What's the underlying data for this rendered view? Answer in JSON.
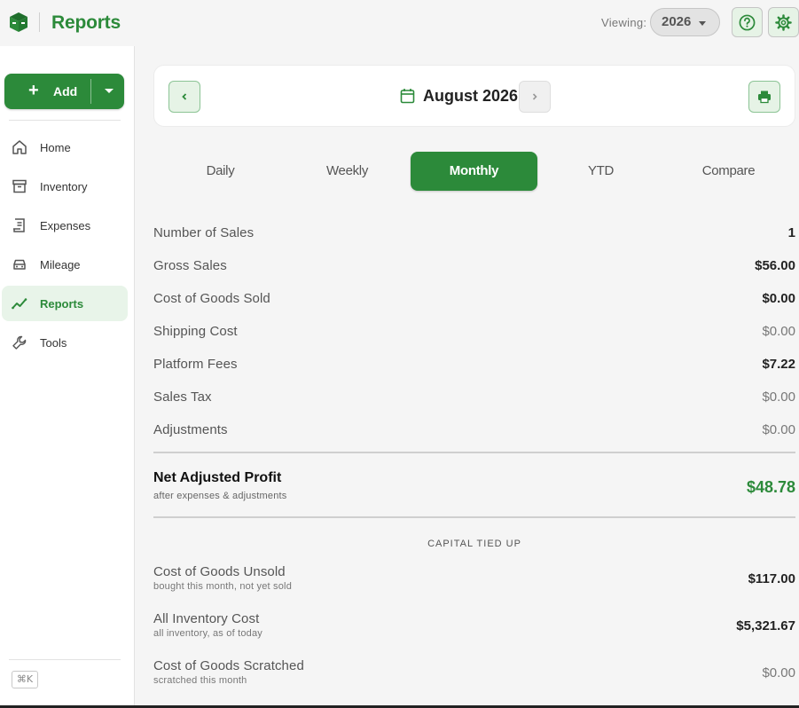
{
  "header": {
    "app_title": "Reports",
    "viewing_label": "Viewing:",
    "year": "2026",
    "help_icon": "help-circle-icon",
    "settings_icon": "gear-icon",
    "accent_color": "#2c8a3a"
  },
  "sidebar": {
    "add_label": "Add",
    "items": [
      {
        "label": "Home",
        "icon": "home-icon",
        "active": false
      },
      {
        "label": "Inventory",
        "icon": "archive-box-icon",
        "active": false
      },
      {
        "label": "Expenses",
        "icon": "receipt-icon",
        "active": false
      },
      {
        "label": "Mileage",
        "icon": "car-icon",
        "active": false
      },
      {
        "label": "Reports",
        "icon": "trend-line-icon",
        "active": true
      },
      {
        "label": "Tools",
        "icon": "wrench-icon",
        "active": false
      }
    ],
    "shortcut": "⌘K"
  },
  "period": {
    "label": "August 2026"
  },
  "tabs": [
    {
      "label": "Daily",
      "active": false
    },
    {
      "label": "Weekly",
      "active": false
    },
    {
      "label": "Monthly",
      "active": true
    },
    {
      "label": "YTD",
      "active": false
    },
    {
      "label": "Compare",
      "active": false
    }
  ],
  "summary": [
    {
      "label": "Number of Sales",
      "value": "1"
    },
    {
      "label": "Gross Sales",
      "value": "$56.00"
    },
    {
      "label": "Cost of Goods Sold",
      "value": "$0.00"
    },
    {
      "label": "Shipping Cost",
      "value": "$0.00"
    },
    {
      "label": "Platform Fees",
      "value": "$7.22"
    },
    {
      "label": "Sales Tax",
      "value": "$0.00"
    },
    {
      "label": "Adjustments",
      "value": "$0.00"
    }
  ],
  "net": {
    "label": "Net Adjusted Profit",
    "sublabel": "after expenses & adjustments",
    "value": "$48.78"
  },
  "capital": {
    "title": "CAPITAL TIED UP",
    "rows": [
      {
        "label": "Cost of Goods Unsold",
        "sublabel": "bought this month, not yet sold",
        "value": "$117.00"
      },
      {
        "label": "All Inventory Cost",
        "sublabel": "all inventory, as of today",
        "value": "$5,321.67"
      },
      {
        "label": "Cost of Goods Scratched",
        "sublabel": "scratched this month",
        "value": "$0.00"
      }
    ]
  }
}
